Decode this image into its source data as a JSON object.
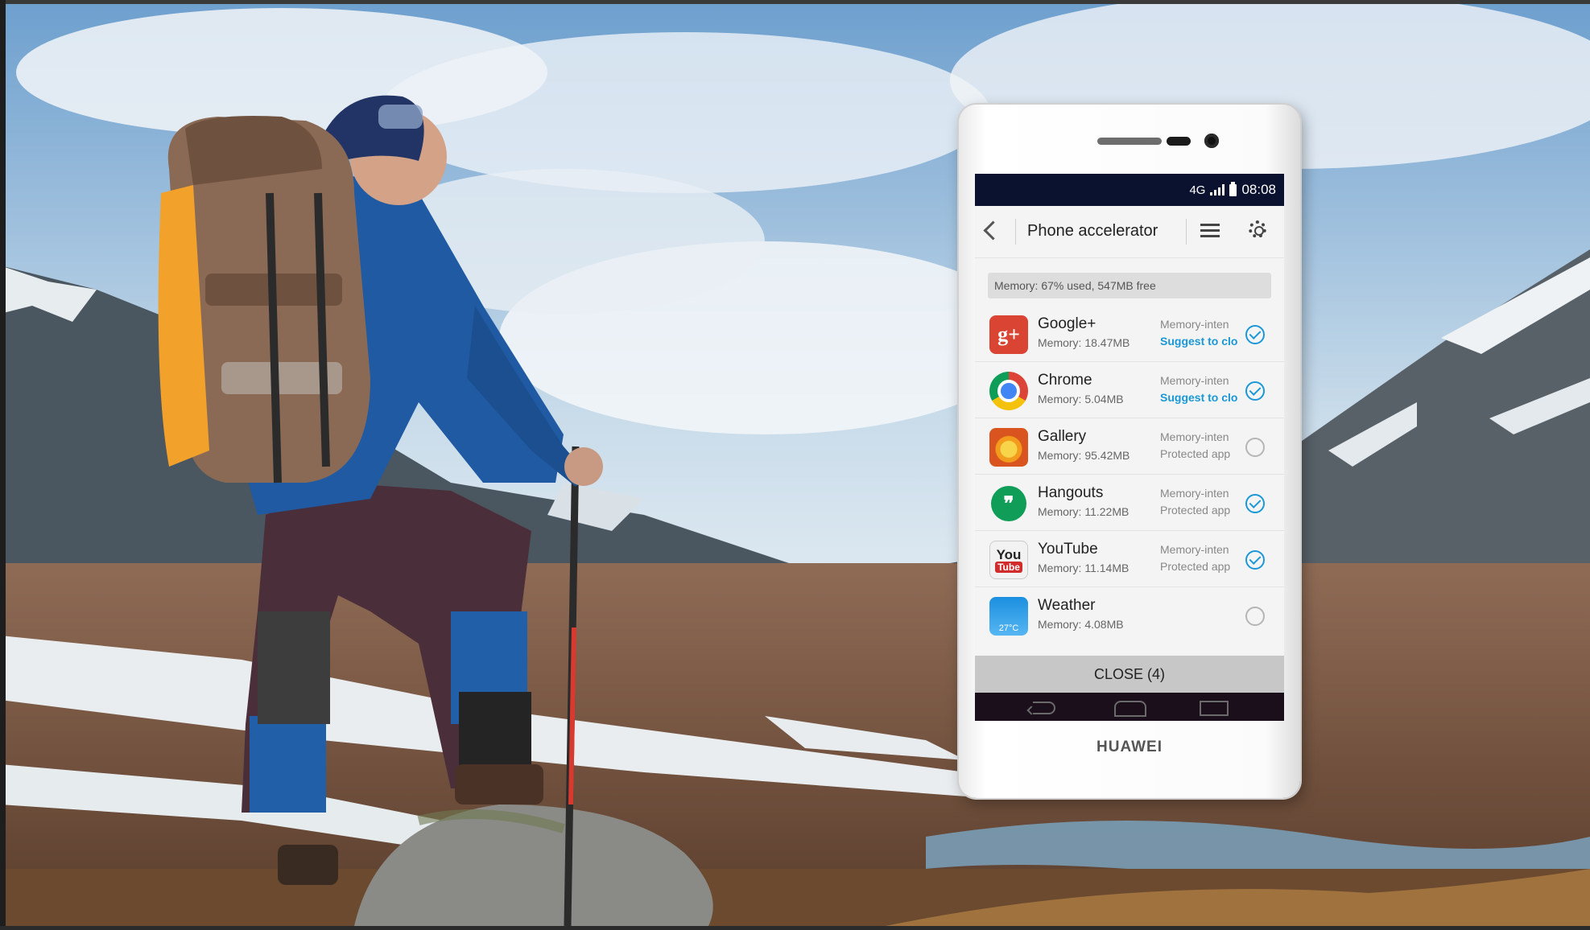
{
  "phone": {
    "brand": "HUAWEI",
    "status": {
      "network": "4G",
      "time": "08:08"
    },
    "title": "Phone accelerator",
    "memory": "Memory: 67% used, 547MB free",
    "apps": [
      {
        "name": "Google+",
        "memory": "Memory: 18.47MB",
        "status": "Memory-inten",
        "note": "Suggest to clo",
        "checked": true,
        "icon": "google-plus-icon"
      },
      {
        "name": "Chrome",
        "memory": "Memory: 5.04MB",
        "status": "Memory-inten",
        "note": "Suggest to clo",
        "checked": true,
        "icon": "chrome-icon"
      },
      {
        "name": "Gallery",
        "memory": "Memory: 95.42MB",
        "status": "Memory-inten",
        "note": "Protected app",
        "checked": false,
        "icon": "gallery-icon"
      },
      {
        "name": "Hangouts",
        "memory": "Memory: 11.22MB",
        "status": "Memory-inten",
        "note": "Protected app",
        "checked": true,
        "icon": "hangouts-icon"
      },
      {
        "name": "YouTube",
        "memory": "Memory: 11.14MB",
        "status": "Memory-inten",
        "note": "Protected app",
        "checked": true,
        "icon": "youtube-icon"
      },
      {
        "name": "Weather",
        "memory": "Memory: 4.08MB",
        "status": "",
        "note": "",
        "checked": false,
        "icon": "weather-icon",
        "icon_text": "27°C"
      }
    ],
    "close_label": "CLOSE (4)",
    "accent_color": "#1a98d5"
  },
  "icons": {
    "google_plus_text": "g+",
    "youtube_top": "You",
    "youtube_bottom": "Tube"
  }
}
